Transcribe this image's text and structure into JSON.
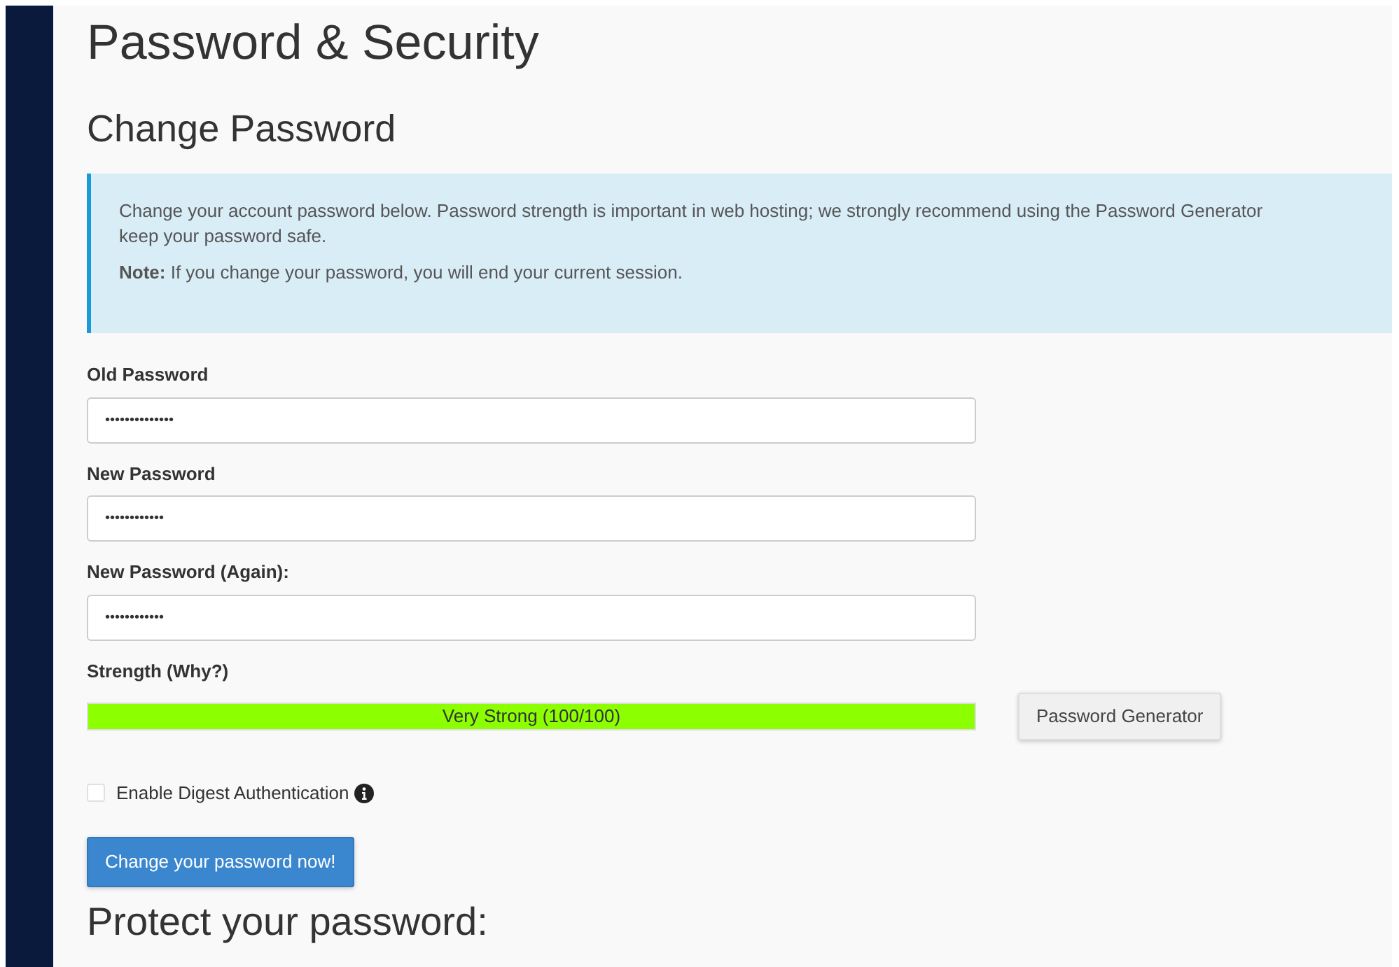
{
  "page_title": "Password & Security",
  "section_title": "Change Password",
  "info_alert": {
    "line_1": "Change your account password below. Password strength is important in web hosting; we strongly recommend using the Password Generator",
    "line_2": "keep your password safe.",
    "note_label": "Note:",
    "note_text": "If you change your password, you will end your current session."
  },
  "fields": [
    {
      "label": "Old Password",
      "value": "••••••••••••••"
    },
    {
      "label": "New Password",
      "value": "••••••••••••"
    },
    {
      "label": "New Password (Again):",
      "value": "••••••••••••"
    }
  ],
  "strength": {
    "label": "Strength (Why?)",
    "level": 1,
    "reading": "Very Strong (100/100)"
  },
  "generator_button": "Password Generator",
  "digest_auth": {
    "label": "Enable Digest Authentication",
    "checked": false
  },
  "submit_button": "Change your password now!",
  "next_section_title": "Protect your password:"
}
